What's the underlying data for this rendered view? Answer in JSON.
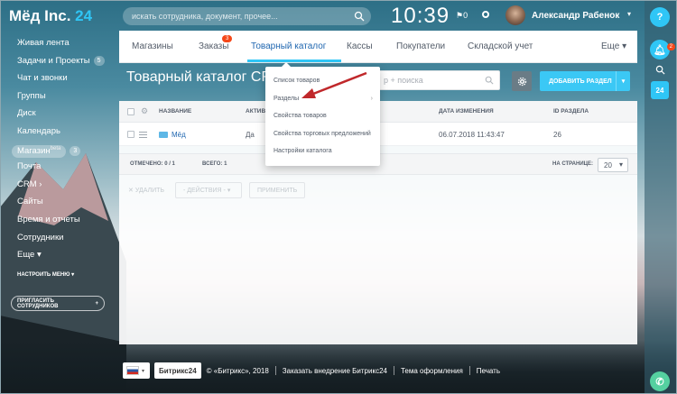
{
  "header": {
    "logo_text": "Мёд Inc.",
    "logo_num": "24",
    "search_placeholder": "искать сотрудника, документ, прочее...",
    "time": "10:39",
    "flag_count": "0",
    "user_name": "Александр Рабенок"
  },
  "sidebar": {
    "items": [
      {
        "label": "Живая лента"
      },
      {
        "label": "Задачи и Проекты",
        "count": "5"
      },
      {
        "label": "Чат и звонки"
      },
      {
        "label": "Группы"
      },
      {
        "label": "Диск"
      },
      {
        "label": "Календарь"
      },
      {
        "label": "Магазин",
        "sup": "beta",
        "count": "3"
      },
      {
        "label": "Почта"
      },
      {
        "label": "CRM"
      },
      {
        "label": "Сайты"
      },
      {
        "label": "Время и отчеты"
      },
      {
        "label": "Сотрудники"
      },
      {
        "label": "Еще"
      }
    ],
    "configure_menu": "НАСТРОИТЬ МЕНЮ",
    "invite": "ПРИГЛАСИТЬ СОТРУДНИКОВ"
  },
  "tabs": {
    "items": [
      {
        "label": "Магазины"
      },
      {
        "label": "Заказы",
        "badge": "3"
      },
      {
        "label": "Товарный каталог"
      },
      {
        "label": "Кассы"
      },
      {
        "label": "Покупатели"
      },
      {
        "label": "Складской учет"
      }
    ],
    "more": "Еще"
  },
  "page": {
    "title": "Товарный каталог CRM",
    "filter_placeholder": "р + поиска",
    "add_button": "ДОБАВИТЬ РАЗДЕЛ"
  },
  "grid": {
    "columns": [
      "НАЗВАНИЕ",
      "АКТИВ",
      "ДАТА ИЗМЕНЕНИЯ",
      "ID РАЗДЕЛА"
    ],
    "rows": [
      {
        "name": "Мёд",
        "active": "Да",
        "changed": "06.07.2018 11:43:47",
        "id": "26"
      }
    ],
    "selected_label": "ОТМЕЧЕНО: 0 / 1",
    "total_label": "ВСЕГО: 1",
    "per_page_label": "НА СТРАНИЦЕ:",
    "per_page_value": "20"
  },
  "actions": {
    "delete": "УДАЛИТЬ",
    "action_select": "- ДЕЙСТВИЯ -",
    "apply": "ПРИМЕНИТЬ"
  },
  "dropdown": {
    "items": [
      {
        "label": "Список товаров"
      },
      {
        "label": "Разделы"
      },
      {
        "label": "Свойства товаров"
      },
      {
        "label": "Свойства торговых предложений"
      },
      {
        "label": "Настройки каталога"
      }
    ]
  },
  "footer": {
    "brand": "Битрикс24",
    "copyright": "© «Битрикс», 2018",
    "order": "Заказать внедрение Битрикс24",
    "theme": "Тема оформления",
    "print": "Печать"
  },
  "rail": {
    "notify_badge": "2",
    "cal_label": "24"
  },
  "colors": {
    "accent": "#2fc6f6",
    "link": "#2067b0",
    "badge": "#f54819"
  }
}
